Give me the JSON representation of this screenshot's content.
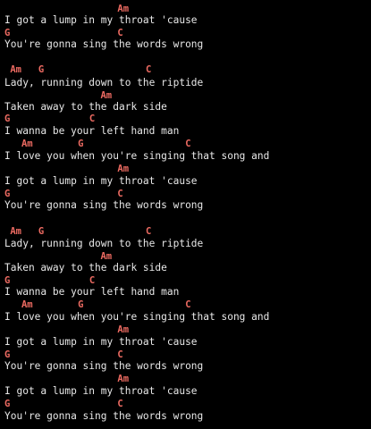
{
  "colors": {
    "background": "#000000",
    "chord": "#ee6b62",
    "lyric": "#e8e8e8"
  },
  "lines": [
    {
      "type": "chord",
      "text": "                    Am"
    },
    {
      "type": "lyric",
      "text": "I got a lump in my throat 'cause"
    },
    {
      "type": "chord",
      "text": "G                   C"
    },
    {
      "type": "lyric",
      "text": "You're gonna sing the words wrong"
    },
    {
      "type": "chord",
      "text": " Am   G                  C"
    },
    {
      "type": "lyric",
      "text": "Lady, running down to the riptide"
    },
    {
      "type": "chord",
      "text": "                 Am"
    },
    {
      "type": "lyric",
      "text": "Taken away to the dark side"
    },
    {
      "type": "chord",
      "text": "G              C"
    },
    {
      "type": "lyric",
      "text": "I wanna be your left hand man"
    },
    {
      "type": "chord",
      "text": "   Am        G                  C"
    },
    {
      "type": "lyric",
      "text": "I love you when you're singing that song and"
    },
    {
      "type": "chord",
      "text": "                    Am"
    },
    {
      "type": "lyric",
      "text": "I got a lump in my throat 'cause"
    },
    {
      "type": "chord",
      "text": "G                   C"
    },
    {
      "type": "lyric",
      "text": "You're gonna sing the words wrong"
    },
    {
      "type": "chord",
      "text": " Am   G                  C"
    },
    {
      "type": "lyric",
      "text": "Lady, running down to the riptide"
    },
    {
      "type": "chord",
      "text": "                 Am"
    },
    {
      "type": "lyric",
      "text": "Taken away to the dark side"
    },
    {
      "type": "chord",
      "text": "G              C"
    },
    {
      "type": "lyric",
      "text": "I wanna be your left hand man"
    },
    {
      "type": "chord",
      "text": "   Am        G                  C"
    },
    {
      "type": "lyric",
      "text": "I love you when you're singing that song and"
    },
    {
      "type": "chord",
      "text": "                    Am"
    },
    {
      "type": "lyric",
      "text": "I got a lump in my throat 'cause"
    },
    {
      "type": "chord",
      "text": "G                   C"
    },
    {
      "type": "lyric",
      "text": "You're gonna sing the words wrong"
    },
    {
      "type": "chord",
      "text": "                    Am"
    },
    {
      "type": "lyric",
      "text": "I got a lump in my throat 'cause"
    },
    {
      "type": "chord",
      "text": "G                   C"
    },
    {
      "type": "lyric",
      "text": "You're gonna sing the words wrong"
    }
  ]
}
